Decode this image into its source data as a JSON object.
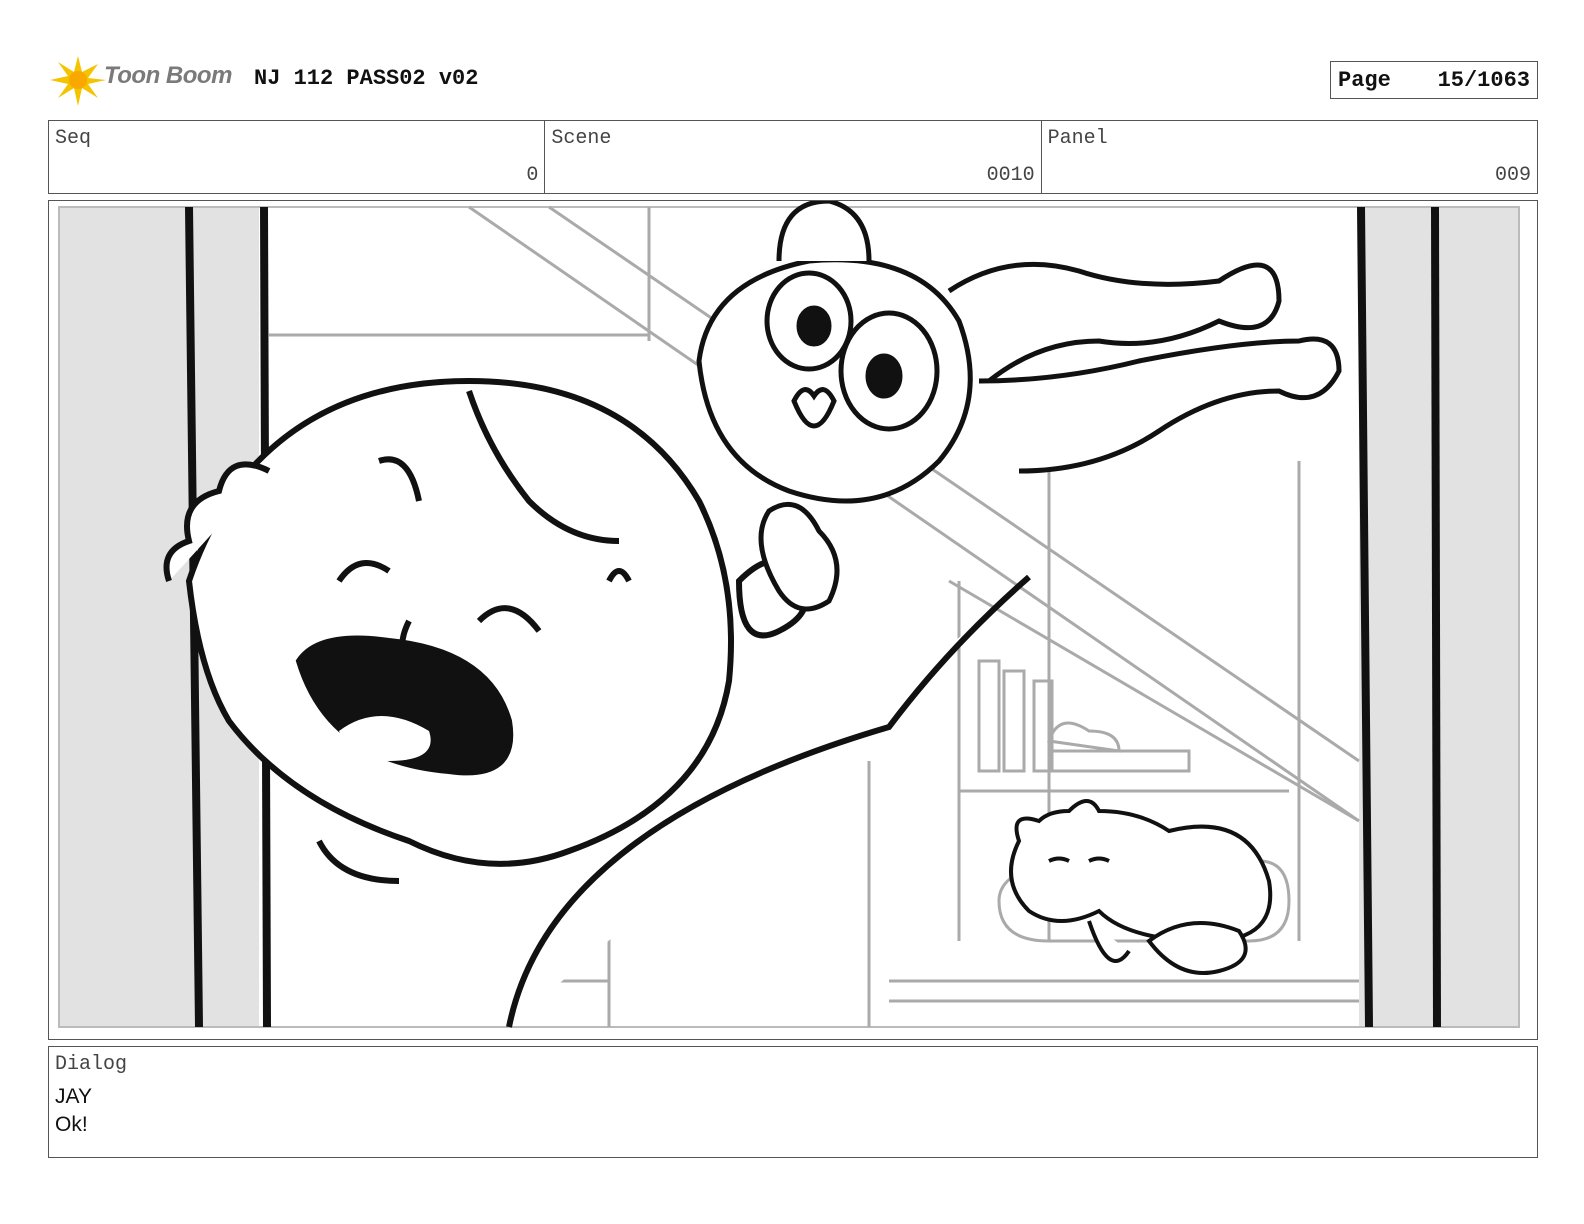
{
  "header": {
    "logo_text": "Toon Boom",
    "title": "NJ 112 PASS02 v02",
    "page_label": "Page",
    "page_number": "15/1063"
  },
  "info": {
    "seq_label": "Seq",
    "seq_value": "0",
    "scene_label": "Scene",
    "scene_value": "0010",
    "panel_label": "Panel",
    "panel_value": "009"
  },
  "panel_image": {
    "icon": "storyboard-sketch",
    "subjects": [
      "boy",
      "monkey-plush",
      "sleeping-cat"
    ]
  },
  "dialog": {
    "label": "Dialog",
    "speaker": "JAY",
    "line": "Ok!"
  },
  "colors": {
    "border": "#555555",
    "logo_yellow": "#f5c400",
    "sketch_grey": "#aaaaaa",
    "ink": "#111111"
  }
}
